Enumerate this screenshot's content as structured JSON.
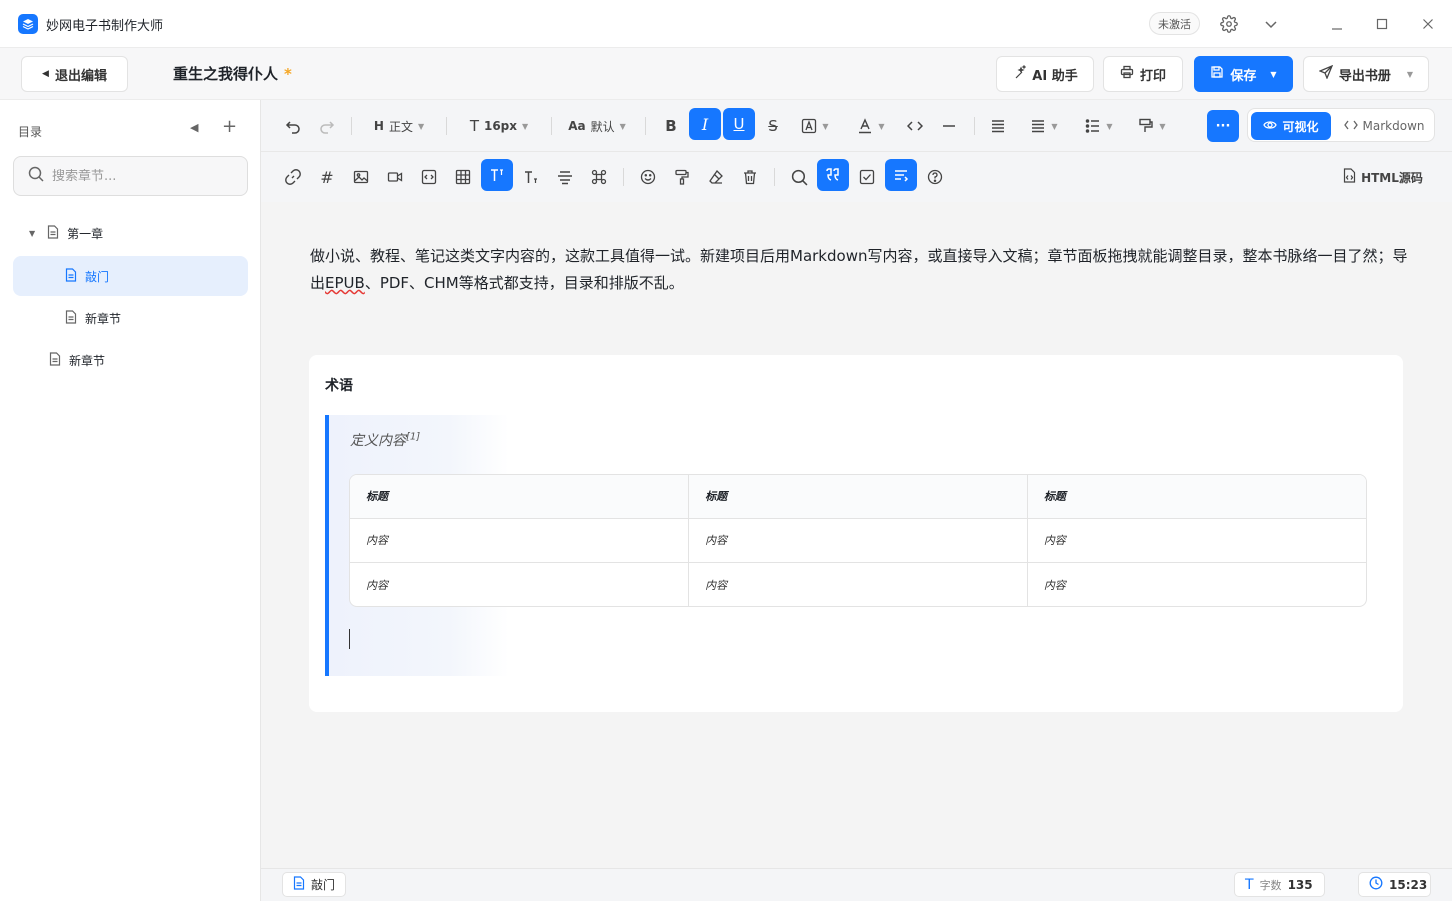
{
  "app": {
    "title": "妙网电子书制作大师",
    "activate_badge": "未激活"
  },
  "header": {
    "exit_label": "退出编辑",
    "doc_title": "重生之我得仆人",
    "unsaved_mark": "*",
    "ai_label": "AI 助手",
    "print_label": "打印",
    "save_label": "保存",
    "export_label": "导出书册"
  },
  "sidebar": {
    "label": "目录",
    "search_placeholder": "搜索章节...",
    "items": [
      {
        "label": "第一章",
        "level": 0,
        "expanded": true
      },
      {
        "label": "敲门",
        "level": 1,
        "selected": true
      },
      {
        "label": "新章节",
        "level": 1
      },
      {
        "label": "新章节",
        "level": 0
      }
    ]
  },
  "toolbar": {
    "heading_label": "正文",
    "font_size": "16px",
    "font_family": "默认",
    "view_visual": "可视化",
    "view_markdown": "Markdown",
    "html_source": "HTML源码",
    "more": "···"
  },
  "editor": {
    "intro_part1": "做小说、教程、笔记这类文字内容的，这款工具值得一试。新建项目后用Markdown写内容，或直接导入文稿；章节面板拖拽就能调整目录，整本书脉络一目了然；导出",
    "intro_epub": "EPUB",
    "intro_part2": "、PDF、CHM等格式都支持，目录和排版不乱。",
    "card_title": "术语",
    "definition": "定义内容",
    "footnote": "[1]",
    "table": {
      "headers": [
        "标题",
        "标题",
        "标题"
      ],
      "rows": [
        [
          "内容",
          "内容",
          "内容"
        ],
        [
          "内容",
          "内容",
          "内容"
        ]
      ]
    }
  },
  "status": {
    "chapter": "敲门",
    "word_count_label": "字数",
    "word_count": "135",
    "time": "15:23"
  },
  "colors": {
    "accent": "#1677ff",
    "star": "#f5a623"
  }
}
